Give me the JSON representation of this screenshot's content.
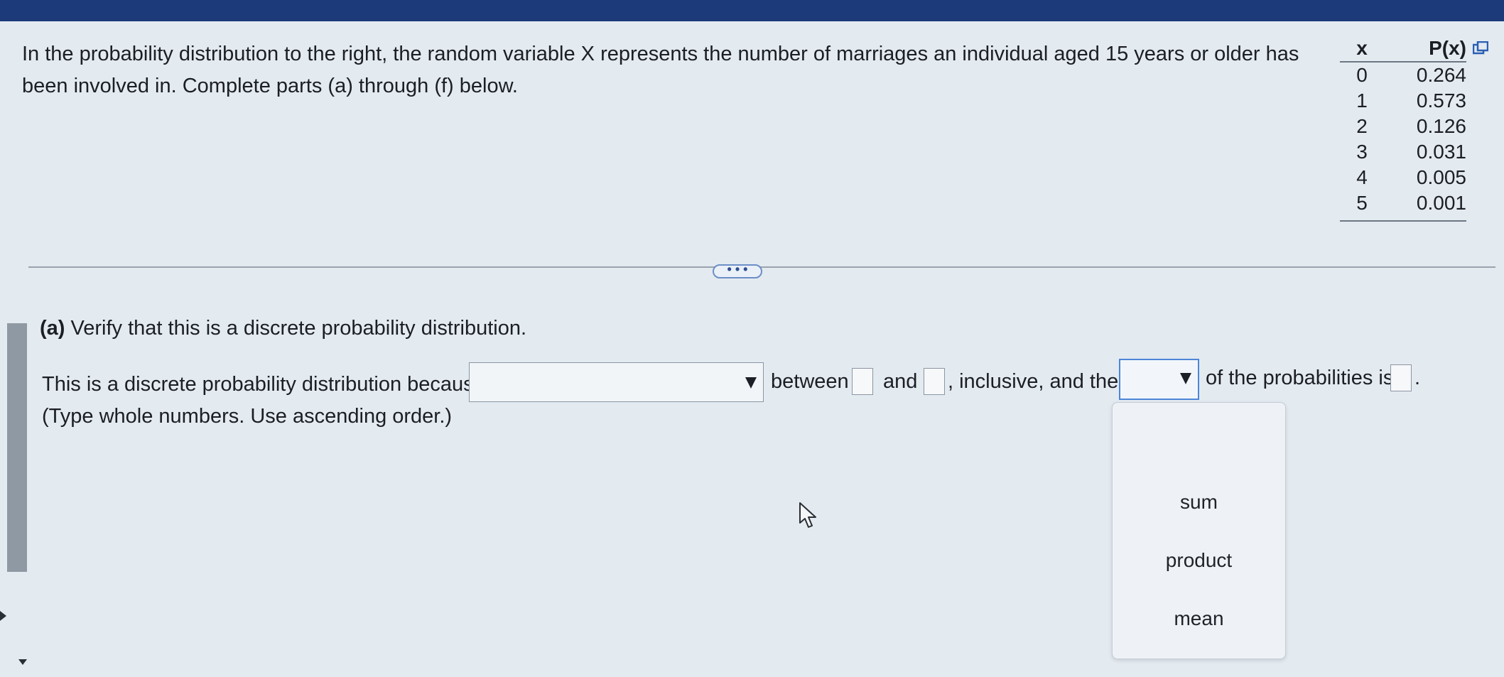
{
  "question": {
    "intro": "In the probability distribution to the right, the random variable X represents the number of marriages an individual aged 15 years or older has been involved in. Complete parts (a) through (f) below."
  },
  "table": {
    "headers": [
      "x",
      "P(x)"
    ],
    "rows": [
      {
        "x": "0",
        "p": "0.264"
      },
      {
        "x": "1",
        "p": "0.573"
      },
      {
        "x": "2",
        "p": "0.126"
      },
      {
        "x": "3",
        "p": "0.031"
      },
      {
        "x": "4",
        "p": "0.005"
      },
      {
        "x": "5",
        "p": "0.001"
      }
    ],
    "copy_icon": "copy-icon"
  },
  "divider": {
    "more_label": "• • •"
  },
  "part_a": {
    "label": "(a)",
    "heading": "Verify that this is a discrete probability distribution.",
    "sentence_start": "This is a discrete probability distribution because",
    "reason_select_value": "",
    "between": "between",
    "and": "and",
    "inclusive": ", inclusive, and the",
    "op_select_value": "",
    "of_probs": "of the probabilities is",
    "period": ".",
    "instruction": "(Type whole numbers. Use ascending order.)"
  },
  "dropdown": {
    "options": [
      "sum",
      "product",
      "mean"
    ]
  },
  "colors": {
    "top_bar": "#1c3a7a",
    "background": "#e3eaf0",
    "focus_border": "#4d86d8"
  }
}
